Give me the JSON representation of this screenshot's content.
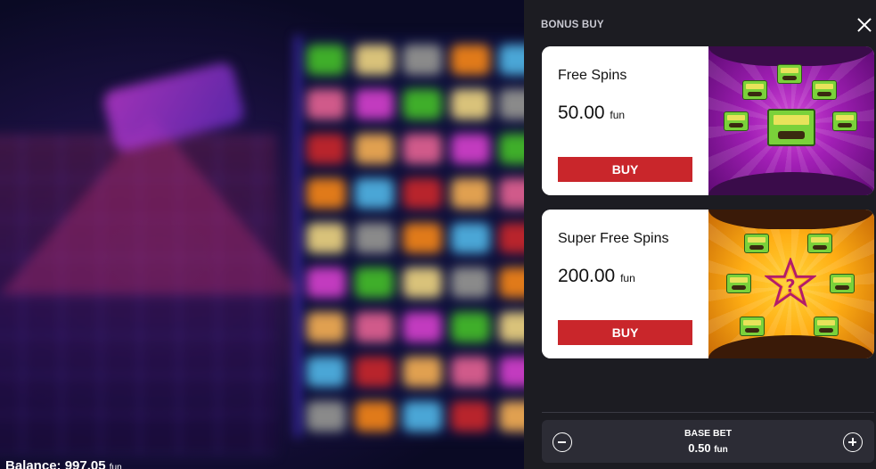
{
  "game": {
    "balance_label": "Balance:",
    "balance_value": "997.05",
    "balance_unit": "fun"
  },
  "bonus_buy": {
    "title": "BONUS BUY",
    "options": [
      {
        "name": "Free Spins",
        "price": "50.00",
        "unit": "fun",
        "buy_label": "BUY",
        "art_symbols": [
          "wild-tape-icon",
          "cassette-tape-icon"
        ]
      },
      {
        "name": "Super Free Spins",
        "price": "200.00",
        "unit": "fun",
        "buy_label": "BUY",
        "art_symbols": [
          "mystery-star-icon",
          "cassette-tape-icon"
        ]
      }
    ]
  },
  "base_bet": {
    "label": "BASE BET",
    "value": "0.50",
    "unit": "fun"
  },
  "colors": {
    "panel_bg": "#1c1c22",
    "buy_button": "#c9262b",
    "card_bg": "#ffffff"
  }
}
